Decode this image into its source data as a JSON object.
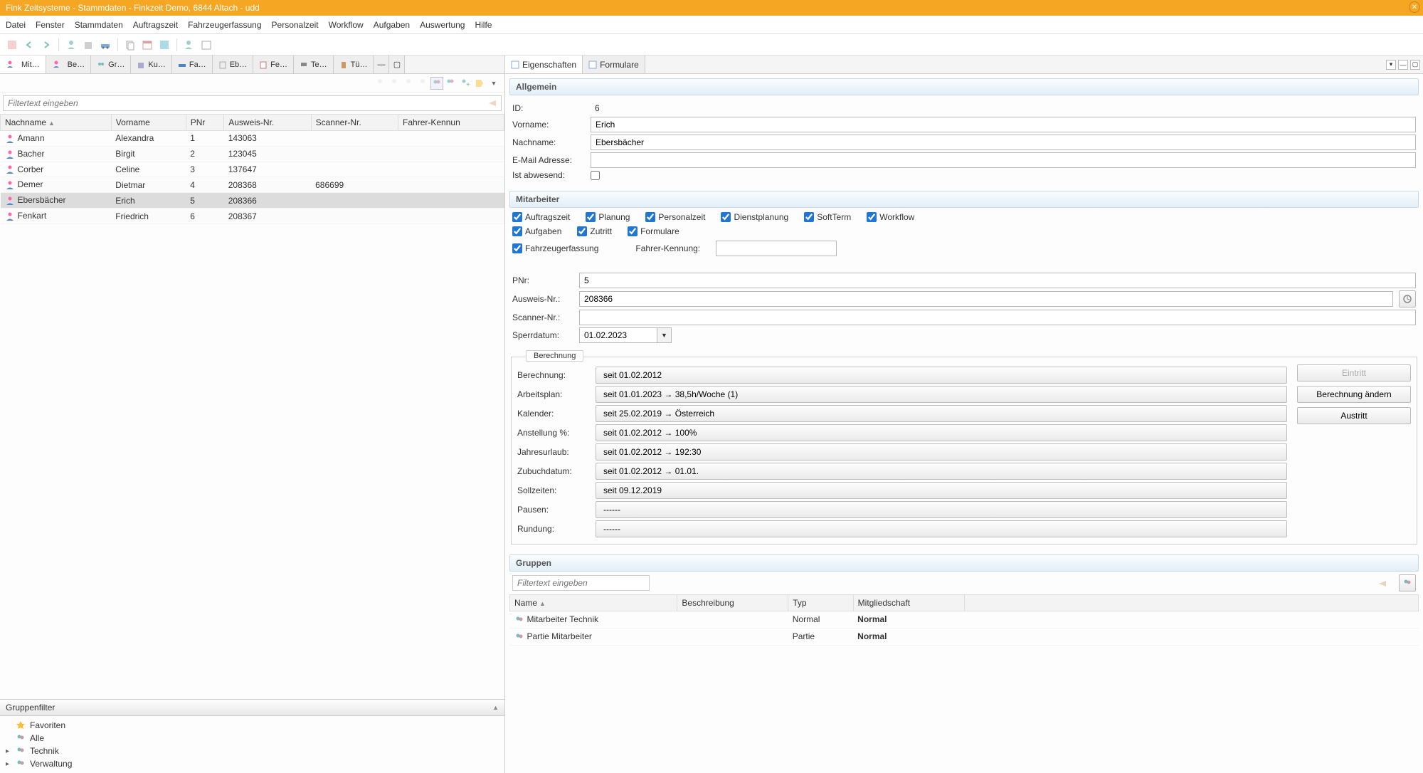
{
  "window_title": "Fink Zeitsysteme - Stammdaten - Finkzeit Demo, 6844 Altach - udd",
  "menu": [
    "Datei",
    "Fenster",
    "Stammdaten",
    "Auftragszeit",
    "Fahrzeugerfassung",
    "Personalzeit",
    "Workflow",
    "Aufgaben",
    "Auswertung",
    "Hilfe"
  ],
  "left_tabs": [
    "Mit…",
    "Be…",
    "Gr…",
    "Ku…",
    "Fa…",
    "Eb…",
    "Fe…",
    "Te…",
    "Tü…"
  ],
  "filter_placeholder": "Filtertext eingeben",
  "table_headers": [
    "Nachname",
    "Vorname",
    "PNr",
    "Ausweis-Nr.",
    "Scanner-Nr.",
    "Fahrer-Kennun"
  ],
  "rows": [
    {
      "nach": "Amann",
      "vor": "Alexandra",
      "pnr": "1",
      "aus": "143063",
      "scan": "",
      "fahr": ""
    },
    {
      "nach": "Bacher",
      "vor": "Birgit",
      "pnr": "2",
      "aus": "123045",
      "scan": "",
      "fahr": ""
    },
    {
      "nach": "Corber",
      "vor": "Celine",
      "pnr": "3",
      "aus": "137647",
      "scan": "",
      "fahr": ""
    },
    {
      "nach": "Demer",
      "vor": "Dietmar",
      "pnr": "4",
      "aus": "208368",
      "scan": "686699",
      "fahr": ""
    },
    {
      "nach": "Ebersbächer",
      "vor": "Erich",
      "pnr": "5",
      "aus": "208366",
      "scan": "",
      "fahr": ""
    },
    {
      "nach": "Fenkart",
      "vor": "Friedrich",
      "pnr": "6",
      "aus": "208367",
      "scan": "",
      "fahr": ""
    }
  ],
  "selected_row_index": 4,
  "gruppenfilter": {
    "label": "Gruppenfilter",
    "items": [
      "Favoriten",
      "Alle",
      "Technik",
      "Verwaltung"
    ]
  },
  "right_tabs": [
    "Eigenschaften",
    "Formulare"
  ],
  "sections": {
    "allgemein": "Allgemein",
    "mitarbeiter": "Mitarbeiter",
    "gruppen": "Gruppen"
  },
  "form": {
    "id_label": "ID:",
    "id_value": "6",
    "vorname_label": "Vorname:",
    "vorname_value": "Erich",
    "nachname_label": "Nachname:",
    "nachname_value": "Ebersbächer",
    "email_label": "E-Mail Adresse:",
    "email_value": "",
    "abwesend_label": "Ist abwesend:"
  },
  "checkboxes": {
    "auftragszeit": "Auftragszeit",
    "planung": "Planung",
    "personalzeit": "Personalzeit",
    "dienstplanung": "Dienstplanung",
    "softterm": "SoftTerm",
    "workflow": "Workflow",
    "aufgaben": "Aufgaben",
    "zutritt": "Zutritt",
    "formulare": "Formulare",
    "fahrzeug": "Fahrzeugerfassung",
    "fahrerkennung_label": "Fahrer-Kennung:"
  },
  "fields2": {
    "pnr_label": "PNr:",
    "pnr_value": "5",
    "ausweis_label": "Ausweis-Nr.:",
    "ausweis_value": "208366",
    "scanner_label": "Scanner-Nr.:",
    "scanner_value": "",
    "sperr_label": "Sperrdatum:",
    "sperr_value": "01.02.2023"
  },
  "berechnung": {
    "legend": "Berechnung",
    "rows": {
      "berechnung_label": "Berechnung:",
      "berechnung_value": "seit 01.02.2012",
      "arbeitsplan_label": "Arbeitsplan:",
      "arbeitsplan_value": "seit 01.01.2023 → 38,5h/Woche (1)",
      "kalender_label": "Kalender:",
      "kalender_value": "seit 25.02.2019 → Österreich",
      "anstell_label": "Anstellung %:",
      "anstell_value": "seit 01.02.2012 → 100%",
      "jahr_label": "Jahresurlaub:",
      "jahr_value": "seit 01.02.2012 → 192:30",
      "zubuch_label": "Zubuchdatum:",
      "zubuch_value": "seit 01.02.2012 → 01.01.",
      "soll_label": "Sollzeiten:",
      "soll_value": "seit 09.12.2019",
      "pausen_label": "Pausen:",
      "pausen_value": "------",
      "rundung_label": "Rundung:",
      "rundung_value": "------"
    },
    "buttons": {
      "eintritt": "Eintritt",
      "berechnung_aendern": "Berechnung ändern",
      "austritt": "Austritt"
    }
  },
  "gruppen_table": {
    "headers": [
      "Name",
      "Beschreibung",
      "Typ",
      "Mitgliedschaft"
    ],
    "rows": [
      {
        "name": "Mitarbeiter Technik",
        "besch": "",
        "typ": "Normal",
        "mit": "Normal"
      },
      {
        "name": "Partie Mitarbeiter",
        "besch": "",
        "typ": "Partie",
        "mit": "Normal"
      }
    ]
  }
}
